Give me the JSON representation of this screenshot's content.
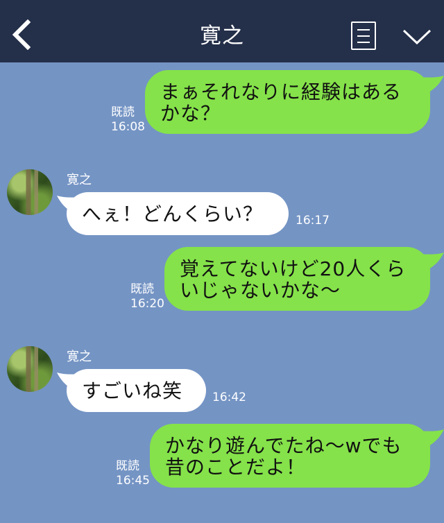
{
  "header": {
    "title": "寛之",
    "back_icon": "chevron-left-icon",
    "menu_icon": "menu-list-icon",
    "collapse_icon": "chevron-down-icon"
  },
  "colors": {
    "header_bg": "#242f49",
    "chat_bg": "#7494c4",
    "sent_bubble": "#85e24a",
    "received_bubble": "#ffffff"
  },
  "messages": [
    {
      "direction": "sent",
      "lines": [
        "まぁそれなりに経験はある",
        "かな？"
      ],
      "read": "既読",
      "time": "16:08"
    },
    {
      "direction": "received",
      "sender": "寛之",
      "lines": [
        "へぇ！どんくらい？"
      ],
      "time": "16:17"
    },
    {
      "direction": "sent",
      "lines": [
        "覚えてないけど20人くら",
        "いじゃないかな〜"
      ],
      "read": "既読",
      "time": "16:20"
    },
    {
      "direction": "received",
      "sender": "寛之",
      "lines": [
        "すごいね笑"
      ],
      "time": "16:42"
    },
    {
      "direction": "sent",
      "lines": [
        "かなり遊んでたね〜wでも",
        "昔のことだよ！"
      ],
      "read": "既読",
      "time": "16:45"
    }
  ]
}
